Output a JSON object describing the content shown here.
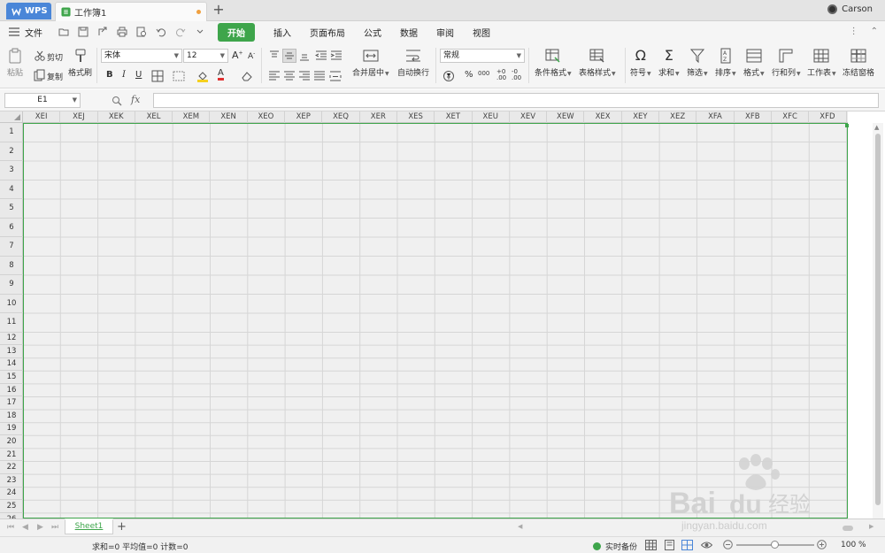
{
  "titlebar": {
    "wps_label": "WPS",
    "doc_title": "工作簿1",
    "new_tab": "+",
    "user_name": "Carson"
  },
  "menubar": {
    "file": "文件",
    "tabs": [
      "开始",
      "插入",
      "页面布局",
      "公式",
      "数据",
      "审阅",
      "视图"
    ],
    "active_tab": "开始"
  },
  "ribbon": {
    "paste": "粘贴",
    "cut": "剪切",
    "copy": "复制",
    "format_painter": "格式刷",
    "font_name": "宋体",
    "font_size": "12",
    "bold": "B",
    "italic": "I",
    "underline": "U",
    "merge_center": "合并居中",
    "wrap_text": "自动换行",
    "number_format": "常规",
    "percent": "%",
    "thousands": "000",
    "dec_inc": ".00",
    "dec_dec": ".00",
    "conditional_format": "条件格式",
    "table_style": "表格样式",
    "symbol": "符号",
    "sum": "求和",
    "filter": "筛选",
    "sort": "排序",
    "format": "格式",
    "rows_cols": "行和列",
    "worksheet": "工作表",
    "freeze": "冻结窗格",
    "font_color": "#e03030",
    "fill_color": "#f5d020"
  },
  "formula_bar": {
    "cell_ref": "E1",
    "fx": "fx",
    "value": ""
  },
  "grid": {
    "columns": [
      "XEI",
      "XEJ",
      "XEK",
      "XEL",
      "XEM",
      "XEN",
      "XEO",
      "XEP",
      "XEQ",
      "XER",
      "XES",
      "XET",
      "XEU",
      "XEV",
      "XEW",
      "XEX",
      "XEY",
      "XEZ",
      "XFA",
      "XFB",
      "XFC",
      "XFD"
    ],
    "rows": [
      "1",
      "2",
      "3",
      "4",
      "5",
      "6",
      "7",
      "8",
      "9",
      "10",
      "11",
      "12",
      "13",
      "14",
      "15",
      "16",
      "17",
      "18",
      "19",
      "20",
      "21",
      "22",
      "23",
      "24",
      "25",
      "26"
    ]
  },
  "sheetbar": {
    "sheet_name": "Sheet1",
    "add": "+"
  },
  "statusbar": {
    "stats": "求和=0  平均值=0  计数=0",
    "backup": "实时备份",
    "zoom": "100 %"
  },
  "watermark": {
    "brand": "Bai du 经验",
    "url": "jingyan.baidu.com"
  },
  "colors": {
    "accent": "#3ea54b",
    "wps_blue": "#4a86d8"
  }
}
